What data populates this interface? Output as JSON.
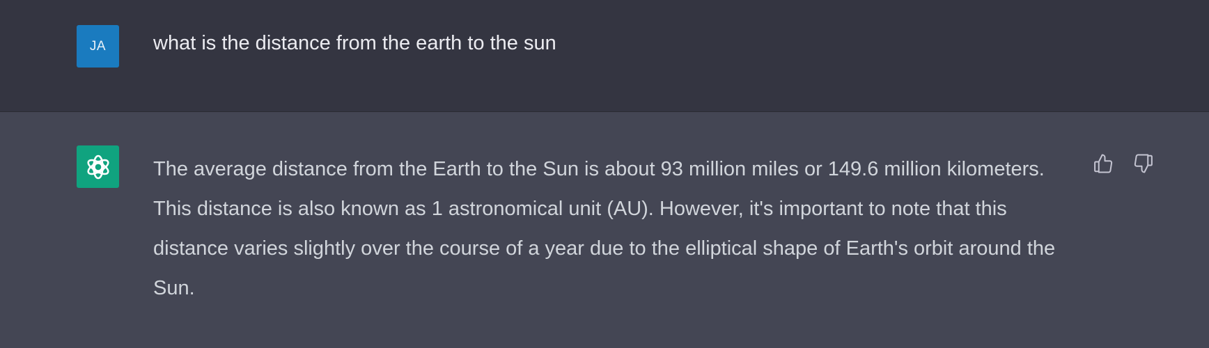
{
  "user_message": {
    "avatar_initials": "JA",
    "text": "what is the distance from the earth to the sun"
  },
  "assistant_message": {
    "avatar_icon": "openai-logo-icon",
    "text": "The average distance from the Earth to the Sun is about 93 million miles or 149.6 million kilometers. This distance is also known as 1 astronomical unit (AU). However, it's important to note that this distance varies slightly over the course of a year due to the elliptical shape of Earth's orbit around the Sun.",
    "feedback_icons": [
      "thumbs-up-icon",
      "thumbs-down-icon"
    ]
  },
  "colors": {
    "user_bg": "#343541",
    "assistant_bg": "#444654",
    "user_avatar": "#1a7bbf",
    "assistant_avatar": "#10a37f",
    "text": "#d1d5db"
  }
}
